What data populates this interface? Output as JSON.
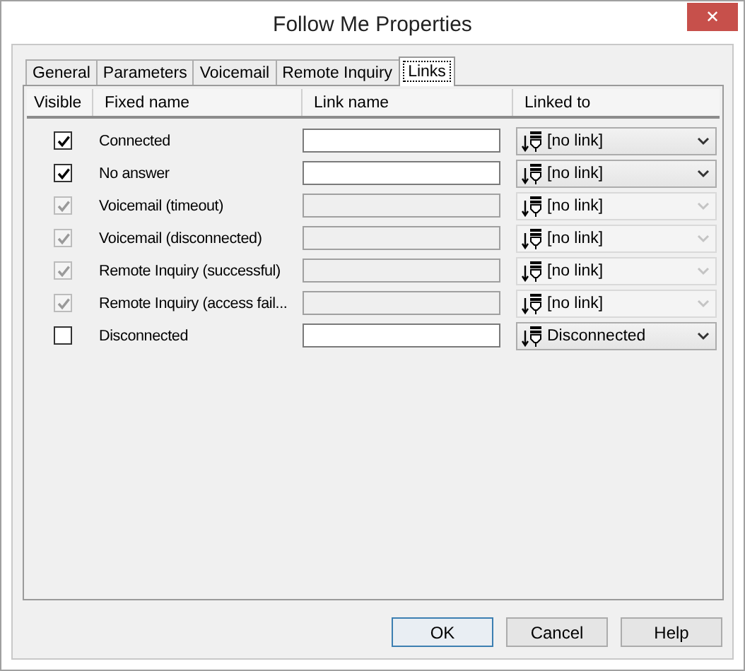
{
  "window": {
    "title": "Follow Me Properties",
    "close": "✕"
  },
  "tabs": [
    {
      "label": "General",
      "selected": false
    },
    {
      "label": "Parameters",
      "selected": false
    },
    {
      "label": "Voicemail",
      "selected": false
    },
    {
      "label": "Remote Inquiry",
      "selected": false
    },
    {
      "label": "Links",
      "selected": true
    }
  ],
  "table": {
    "columns": [
      "Visible",
      "Fixed name",
      "Link name",
      "Linked to"
    ],
    "rows": [
      {
        "checked": true,
        "disabled": false,
        "fixed_name": "Connected",
        "linked_to": "[no link]"
      },
      {
        "checked": true,
        "disabled": false,
        "fixed_name": "No answer",
        "linked_to": "[no link]"
      },
      {
        "checked": true,
        "disabled": true,
        "fixed_name": "Voicemail (timeout)",
        "linked_to": "[no link]"
      },
      {
        "checked": true,
        "disabled": true,
        "fixed_name": "Voicemail (disconnected)",
        "linked_to": "[no link]"
      },
      {
        "checked": true,
        "disabled": true,
        "fixed_name": "Remote Inquiry (successful)",
        "linked_to": "[no link]"
      },
      {
        "checked": true,
        "disabled": true,
        "fixed_name": "Remote Inquiry (access fail...",
        "linked_to": "[no link]"
      },
      {
        "checked": false,
        "disabled": false,
        "fixed_name": "Disconnected",
        "linked_to": "Disconnected"
      }
    ]
  },
  "buttons": [
    {
      "label": "OK",
      "default": true
    },
    {
      "label": "Cancel",
      "default": false
    },
    {
      "label": "Help",
      "default": false
    }
  ]
}
